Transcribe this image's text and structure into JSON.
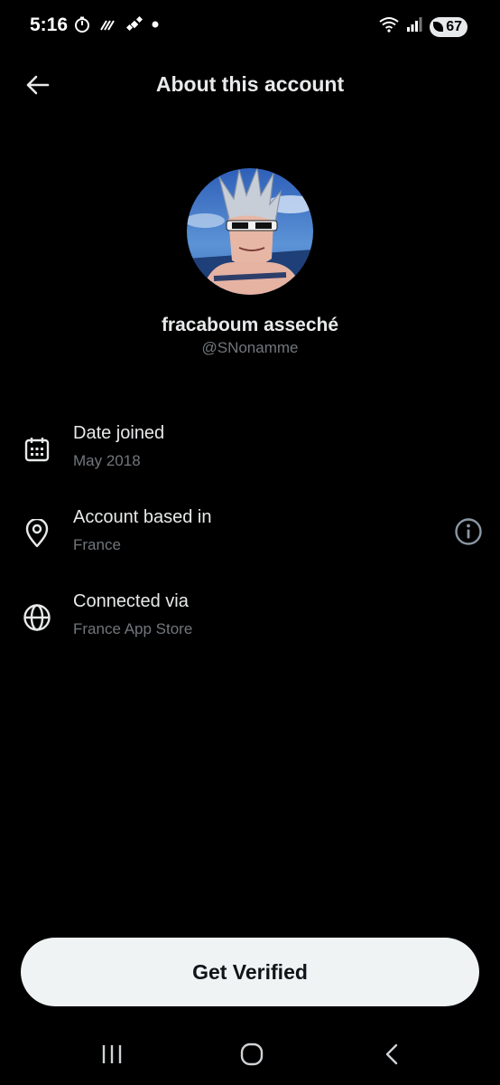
{
  "status_bar": {
    "time": "5:16",
    "battery": "67",
    "icons": [
      "timer-icon",
      "wifi-calling-icon",
      "satellite-icon",
      "dot-icon",
      "wifi-icon",
      "signal-icon",
      "battery-icon"
    ]
  },
  "header": {
    "title": "About this account",
    "back_icon": "back-arrow-icon"
  },
  "profile": {
    "display_name": "fracaboum asseché",
    "handle": "@SNonamme",
    "avatar": "anime-character-avatar"
  },
  "info": [
    {
      "icon": "calendar-icon",
      "label": "Date joined",
      "value": "May 2018"
    },
    {
      "icon": "location-pin-icon",
      "label": "Account based in",
      "value": "France",
      "extra_icon": "info-circle-icon"
    },
    {
      "icon": "globe-icon",
      "label": "Connected via",
      "value": "France App Store"
    }
  ],
  "cta": {
    "label": "Get Verified"
  },
  "nav": [
    "recents-icon",
    "home-icon",
    "back-icon"
  ],
  "colors": {
    "background": "#000000",
    "primary_text": "#e7e9ea",
    "secondary_text": "#71767b",
    "button_bg": "#eff3f4",
    "button_text": "#0f1419"
  }
}
